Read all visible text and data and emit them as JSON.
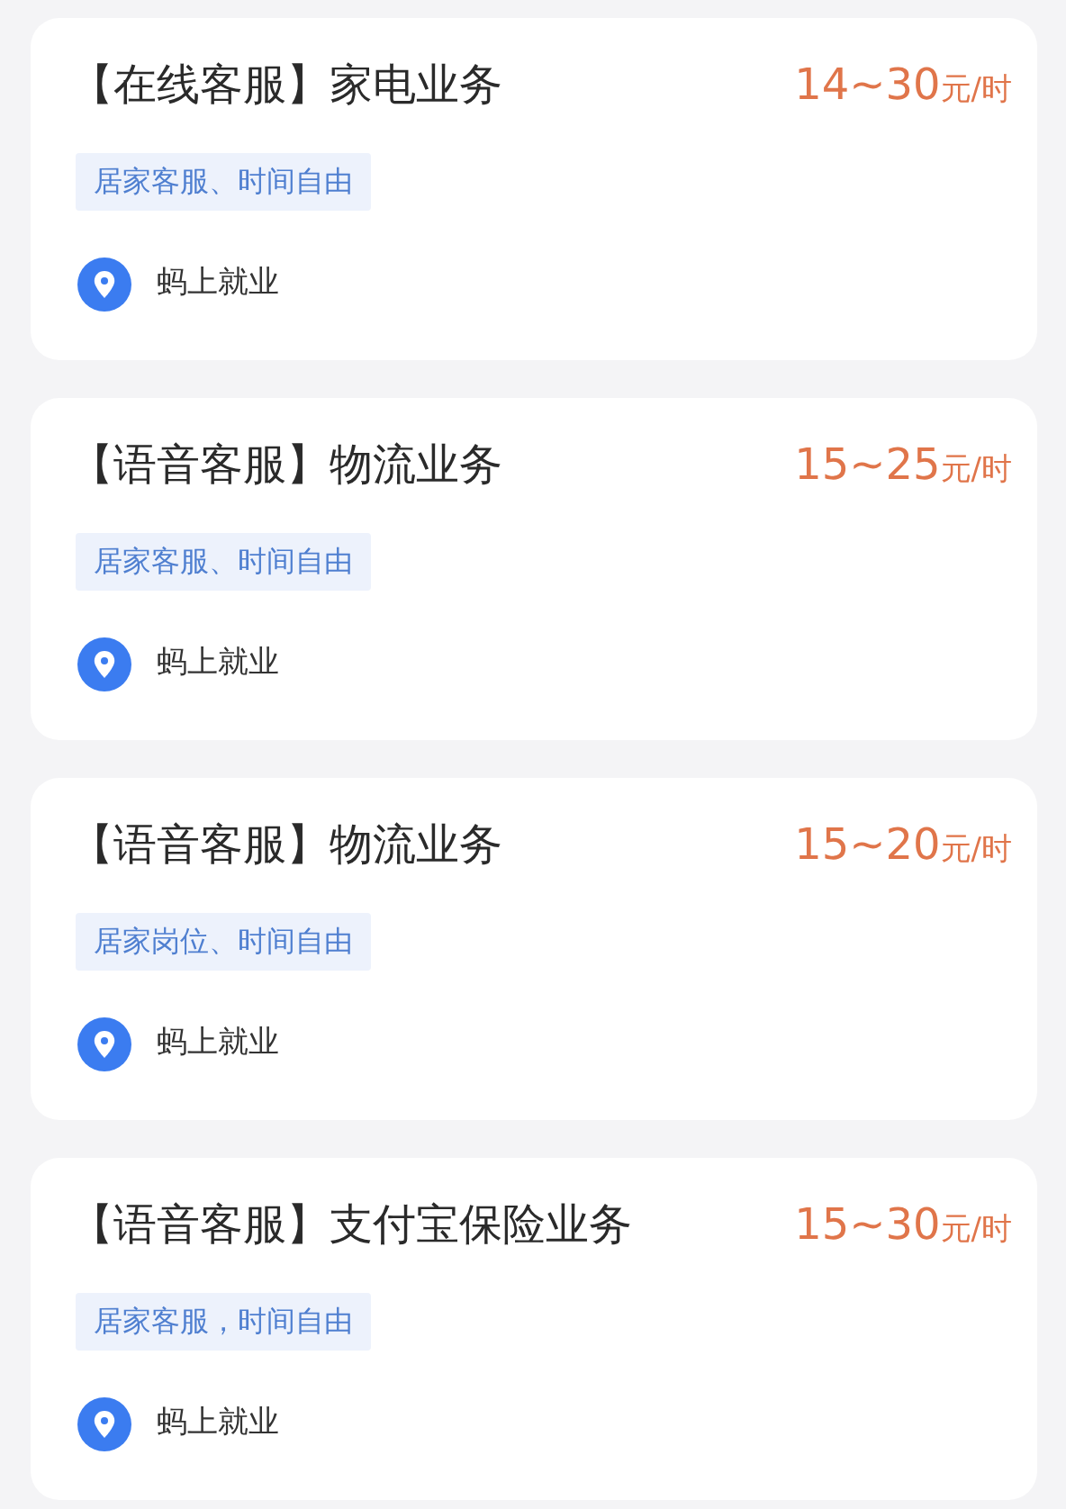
{
  "jobs": [
    {
      "title": "【在线客服】家电业务",
      "salary": "14~30",
      "unit": "元/时",
      "tag": "居家客服、时间自由",
      "company": "蚂上就业"
    },
    {
      "title": "【语音客服】物流业务",
      "salary": "15~25",
      "unit": "元/时",
      "tag": "居家客服、时间自由",
      "company": "蚂上就业"
    },
    {
      "title": "【语音客服】物流业务",
      "salary": "15~20",
      "unit": "元/时",
      "tag": "居家岗位、时间自由",
      "company": "蚂上就业"
    },
    {
      "title": "【语音客服】支付宝保险业务",
      "salary": "15~30",
      "unit": "元/时",
      "tag": "居家客服，时间自由",
      "company": "蚂上就业"
    }
  ]
}
